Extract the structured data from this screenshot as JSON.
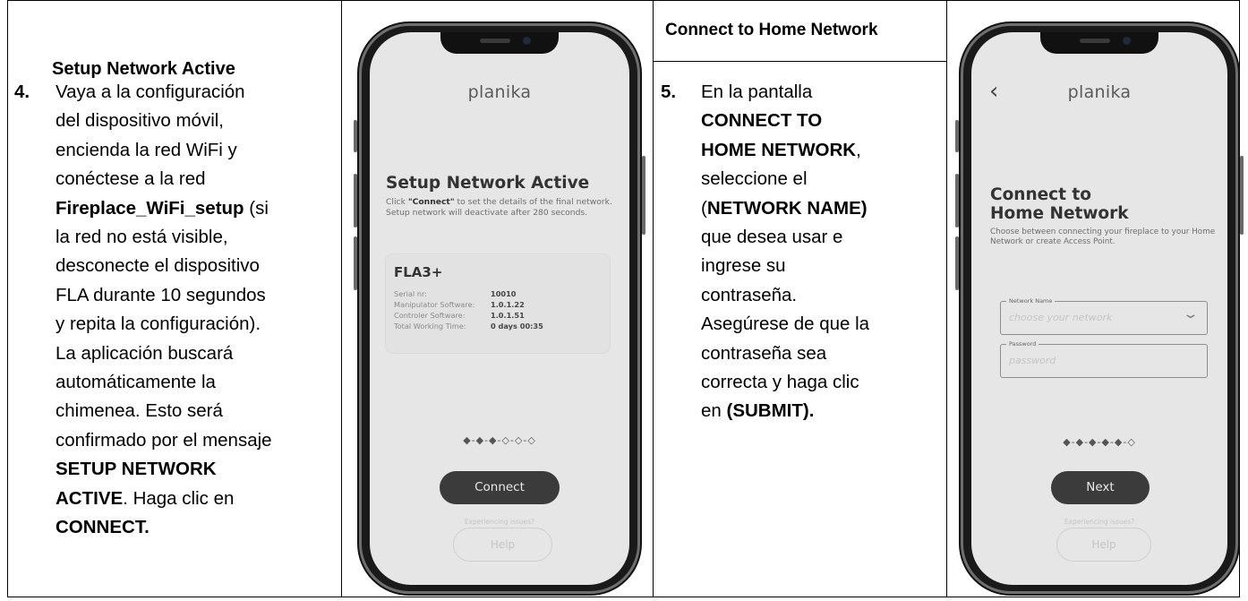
{
  "col1": {
    "title": "Setup Network Active",
    "step_number": "4.",
    "lines": [
      [
        {
          "t": "Vaya a la configuración",
          "b": false
        }
      ],
      [
        {
          "t": "del dispositivo móvil,",
          "b": false
        }
      ],
      [
        {
          "t": "encienda la red WiFi y",
          "b": false
        }
      ],
      [
        {
          "t": "conéctese a la red",
          "b": false
        }
      ],
      [
        {
          "t": "Fireplace_WiFi_setup",
          "b": true
        },
        {
          "t": " (si",
          "b": false
        }
      ],
      [
        {
          "t": "la red no está visible,",
          "b": false
        }
      ],
      [
        {
          "t": "desconecte el dispositivo",
          "b": false
        }
      ],
      [
        {
          "t": "FLA durante 10 segundos",
          "b": false
        }
      ],
      [
        {
          "t": "y repita la configuración).",
          "b": false
        }
      ],
      [
        {
          "t": "La aplicación buscará",
          "b": false
        }
      ],
      [
        {
          "t": "automáticamente la",
          "b": false
        }
      ],
      [
        {
          "t": "chimenea. Esto será",
          "b": false
        }
      ],
      [
        {
          "t": "confirmado por el mensaje",
          "b": false
        }
      ],
      [
        {
          "t": "SETUP NETWORK",
          "b": true
        }
      ],
      [
        {
          "t": "ACTIVE",
          "b": true
        },
        {
          "t": ". Haga clic en",
          "b": false
        }
      ],
      [
        {
          "t": "CONNECT.",
          "b": true
        }
      ]
    ]
  },
  "col3": {
    "title": "Connect to Home Network",
    "step_number": "5.",
    "lines": [
      [
        {
          "t": "En la pantalla",
          "b": false
        }
      ],
      [
        {
          "t": "CONNECT TO",
          "b": true
        }
      ],
      [
        {
          "t": "HOME NETWORK",
          "b": true
        },
        {
          "t": ",",
          "b": false
        }
      ],
      [
        {
          "t": "seleccione el",
          "b": false
        }
      ],
      [
        {
          "t": "(",
          "b": false
        },
        {
          "t": "NETWORK NAME)",
          "b": true
        }
      ],
      [
        {
          "t": "que desea usar e",
          "b": false
        }
      ],
      [
        {
          "t": "ingrese su",
          "b": false
        }
      ],
      [
        {
          "t": "contraseña.",
          "b": false
        }
      ],
      [
        {
          "t": "Asegúrese de que la",
          "b": false
        }
      ],
      [
        {
          "t": "contraseña sea",
          "b": false
        }
      ],
      [
        {
          "t": "correcta y haga clic",
          "b": false
        }
      ],
      [
        {
          "t": "en ",
          "b": false
        },
        {
          "t": "(SUBMIT).",
          "b": true
        }
      ]
    ]
  },
  "phone1": {
    "brand": "planika",
    "title": "Setup Network Active",
    "desc_before": "Click ",
    "desc_bold": "\"Connect\"",
    "desc_after": " to set the details of the final network. Setup network will deactivate after 280 seconds.",
    "device": {
      "name": "FLA3+",
      "rows": [
        {
          "label": "Serial nr:",
          "value": "10010"
        },
        {
          "label": "Manipulator Software:",
          "value": "1.0.1.22"
        },
        {
          "label": "Controler Software:",
          "value": "1.0.1.51"
        },
        {
          "label": "Total Working Time:",
          "value": "0 days  00:35"
        }
      ]
    },
    "progress_dots": "◆-◆-◆-◇-◇-◇",
    "primary_button": "Connect",
    "issues_text": "Experiencing issues?",
    "help_button": "Help"
  },
  "phone2": {
    "brand": "planika",
    "back_icon": "‹",
    "title_line1": "Connect to",
    "title_line2": "Home Network",
    "desc": "Choose between connecting your fireplace to your Home Network or create Access Point.",
    "network_field": {
      "label": "Network Name",
      "placeholder": "choose your network",
      "icon": "chevron-down-icon"
    },
    "password_field": {
      "label": "Password",
      "placeholder": "password"
    },
    "progress_dots": "◆-◆-◆-◆-◆-◇",
    "primary_button": "Next",
    "issues_text": "Experiencing issues?",
    "help_button": "Help"
  }
}
